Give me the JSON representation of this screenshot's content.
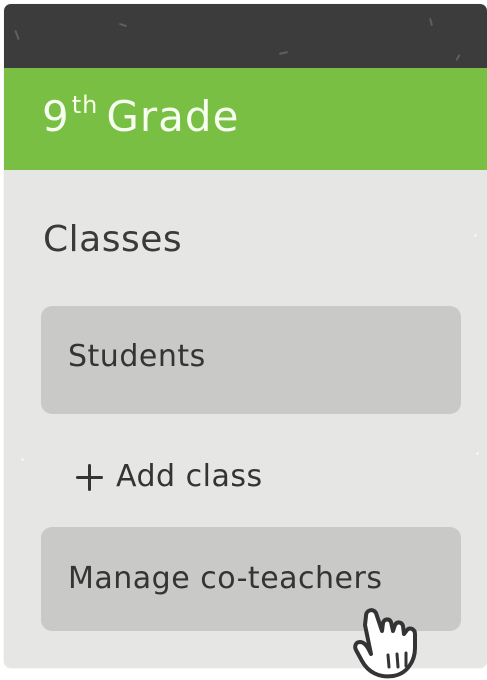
{
  "header": {
    "grade_number": "9",
    "grade_suffix": "th",
    "grade_label": "Grade"
  },
  "section": {
    "title": "Classes"
  },
  "items": {
    "students": "Students",
    "add_class": "Add class",
    "manage_coteachers": "Manage co-teachers"
  },
  "icons": {
    "plus": "plus-icon",
    "cursor": "hand-pointer-icon"
  },
  "colors": {
    "topbar": "#3c3c3c",
    "header": "#78bf43",
    "panel": "#e6e6e5",
    "item_background": "#c9c9c8",
    "text": "#343434"
  }
}
